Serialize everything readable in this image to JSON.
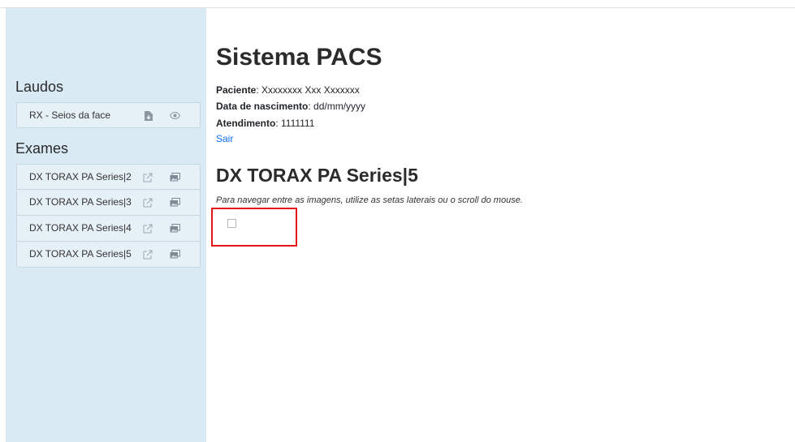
{
  "sidebar": {
    "laudos_title": "Laudos",
    "laudos": [
      {
        "label": "RX - Seios da face",
        "icons": [
          "file-download-icon",
          "eye-icon"
        ]
      }
    ],
    "exames_title": "Exames",
    "exames": [
      {
        "label": "DX TORAX PA Series|2",
        "icons": [
          "external-link-icon",
          "images-icon"
        ]
      },
      {
        "label": "DX TORAX PA Series|3",
        "icons": [
          "external-link-icon",
          "images-icon"
        ]
      },
      {
        "label": "DX TORAX PA Series|4",
        "icons": [
          "external-link-icon",
          "images-icon"
        ]
      },
      {
        "label": "DX TORAX PA Series|5",
        "icons": [
          "external-link-icon",
          "images-icon"
        ]
      }
    ]
  },
  "main": {
    "title": "Sistema PACS",
    "patient_label": "Paciente",
    "patient_value": ": Xxxxxxxx Xxx Xxxxxxx",
    "dob_label": "Data de nascimento",
    "dob_value": ": dd/mm/yyyy",
    "atendimento_label": "Atendimento",
    "atendimento_value": ": 1111111",
    "logout_label": "Sair",
    "series_title": "DX TORAX PA Series|5",
    "navigation_hint": "Para navegar entre as imagens, utilize as setas laterais ou o scroll do mouse."
  },
  "colors": {
    "sidebar_bg": "#d9eaf5",
    "link": "#0d6efd",
    "highlight_border": "#e8141c"
  }
}
